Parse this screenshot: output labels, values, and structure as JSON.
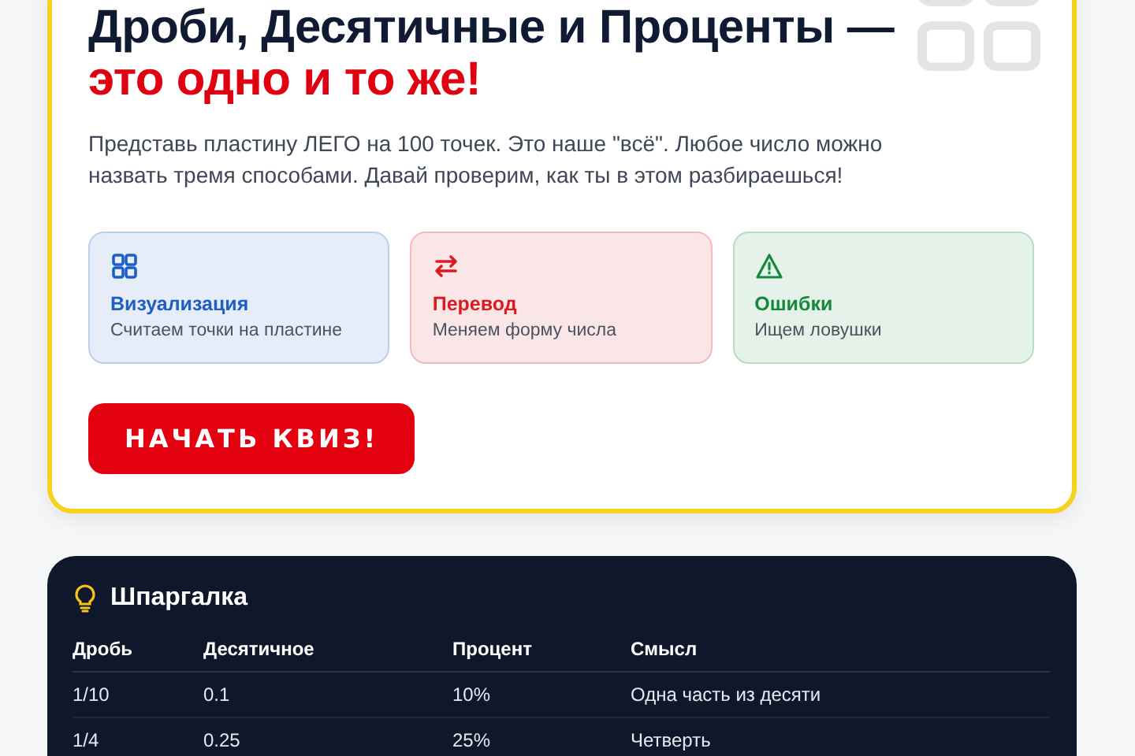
{
  "hero": {
    "title": "Дроби, Десятичные и Проценты —",
    "title_accent": "это одно и то же!",
    "intro": "Представь пластину ЛЕГО на 100 точек. Это наше \"всё\". Любое число можно назвать тремя способами. Давай проверим, как ты в этом разбираешься!",
    "features": [
      {
        "kind": "grid",
        "title": "Визуализация",
        "subtitle": "Считаем точки на пластине",
        "color": "#1d5fc4"
      },
      {
        "kind": "swap",
        "title": "Перевод",
        "subtitle": "Меняем форму числа",
        "color": "#dc1a22"
      },
      {
        "kind": "warning",
        "title": "Ошибки",
        "subtitle": "Ищем ловушки",
        "color": "#16883a"
      }
    ],
    "button": "НАЧАТЬ КВИЗ!"
  },
  "cheatsheet": {
    "title": "Шпаргалка",
    "columns": [
      "Дробь",
      "Десятичное",
      "Процент",
      "Смысл"
    ],
    "rows": [
      [
        "1/10",
        "0.1",
        "10%",
        "Одна часть из десяти"
      ],
      [
        "1/4",
        "0.25",
        "25%",
        "Четверть"
      ]
    ]
  }
}
